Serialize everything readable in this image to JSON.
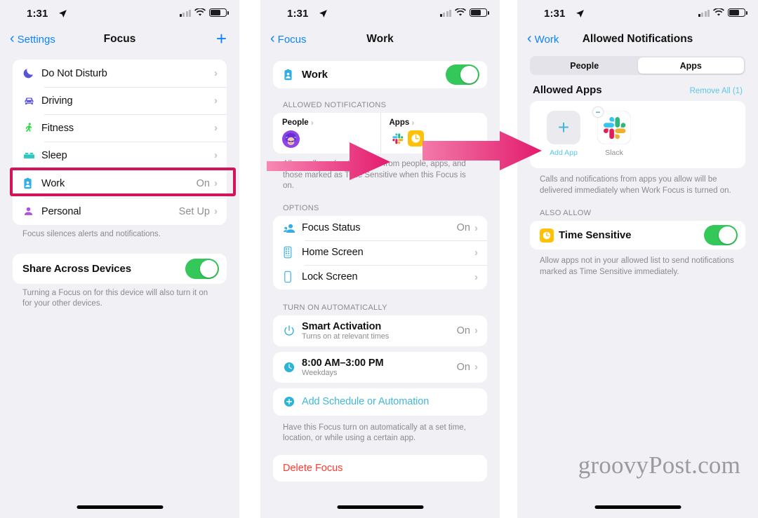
{
  "status_bar": {
    "time": "1:31",
    "location_icon": "location-arrow-icon",
    "wifi_icon": "wifi-icon",
    "battery_icon": "battery-icon"
  },
  "colors": {
    "accent_blue": "#0a84ff",
    "toggle_green": "#34c759",
    "highlight_pink": "#d3145a",
    "arrow_pink": "#e31b6d",
    "destructive_red": "#ff3b30",
    "teal_link": "#5ac8e8",
    "panel_bg": "#f1f0f5"
  },
  "panel1": {
    "nav": {
      "back_label": "Settings",
      "title": "Focus",
      "add_label": "+"
    },
    "focus_list": [
      {
        "label": "Do Not Disturb",
        "value": "",
        "icon": "moon-icon"
      },
      {
        "label": "Driving",
        "value": "",
        "icon": "car-icon"
      },
      {
        "label": "Fitness",
        "value": "",
        "icon": "running-person-icon"
      },
      {
        "label": "Sleep",
        "value": "",
        "icon": "bed-icon"
      },
      {
        "label": "Work",
        "value": "On",
        "icon": "badge-id-icon"
      },
      {
        "label": "Personal",
        "value": "Set Up",
        "icon": "person-icon"
      }
    ],
    "footnote": "Focus silences alerts and notifications.",
    "share_row": {
      "label": "Share Across Devices",
      "toggle": "on"
    },
    "share_footnote": "Turning a Focus on for this device will also turn it on for your other devices."
  },
  "panel2": {
    "nav": {
      "back_label": "Focus",
      "title": "Work"
    },
    "work_row": {
      "label": "Work",
      "toggle": "on",
      "icon": "badge-id-icon"
    },
    "allowed_notifications": {
      "header": "ALLOWED NOTIFICATIONS",
      "people": {
        "label": "People",
        "icons": [
          "avatar-memoji-icon"
        ]
      },
      "apps": {
        "label": "Apps",
        "icons": [
          "slack-icon",
          "clock-yellow-icon"
        ]
      },
      "footnote": "Allow calls and notifications from people, apps, and those marked as Time Sensitive when this Focus is on."
    },
    "options": {
      "header": "OPTIONS",
      "rows": [
        {
          "label": "Focus Status",
          "value": "On",
          "icon": "focus-status-icon"
        },
        {
          "label": "Home Screen",
          "value": "",
          "icon": "home-screen-icon"
        },
        {
          "label": "Lock Screen",
          "value": "",
          "icon": "lock-screen-icon"
        }
      ]
    },
    "turn_on_automatically": {
      "header": "TURN ON AUTOMATICALLY",
      "rows": [
        {
          "label": "Smart Activation",
          "sub": "Turns on at relevant times",
          "value": "On",
          "icon": "power-icon"
        },
        {
          "label": "8:00 AM–3:00 PM",
          "sub": "Weekdays",
          "value": "On",
          "icon": "clock-icon"
        }
      ],
      "add_label": "Add Schedule or Automation",
      "footnote": "Have this Focus turn on automatically at a set time, location, or while using a certain app."
    },
    "delete_label": "Delete Focus"
  },
  "panel3": {
    "nav": {
      "back_label": "Work",
      "title": "Allowed Notifications"
    },
    "segments": [
      {
        "label": "People",
        "active": false
      },
      {
        "label": "Apps",
        "active": true
      }
    ],
    "allowed_apps": {
      "title": "Allowed Apps",
      "remove_all": "Remove All (1)",
      "apps": [
        {
          "caption": "Add App",
          "icon": "plus-add-app-icon",
          "type": "add"
        },
        {
          "caption": "Slack",
          "icon": "slack-icon",
          "type": "app",
          "badge": "minus-remove-icon"
        }
      ],
      "footnote": "Calls and notifications from apps you allow will be delivered immediately when Work Focus is turned on."
    },
    "also_allow": {
      "header": "ALSO ALLOW",
      "row": {
        "label": "Time Sensitive",
        "toggle": "on",
        "icon": "clock-yellow-icon"
      },
      "footnote": "Allow apps not in your allowed list to send notifications marked as Time Sensitive immediately."
    }
  },
  "watermark": {
    "text": "groovyPost.com"
  }
}
